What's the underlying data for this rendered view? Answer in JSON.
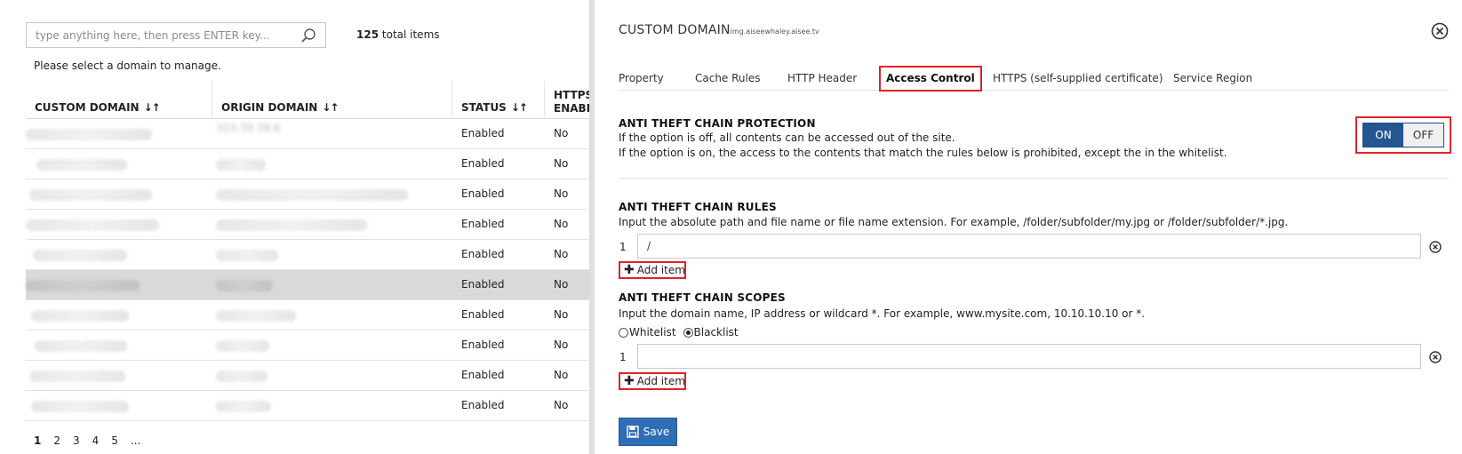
{
  "search": {
    "placeholder": "type anything here, then press ENTER key...",
    "total_count": "125",
    "total_suffix": "total items"
  },
  "select_message": "Please select a domain to manage.",
  "table": {
    "headers": {
      "custom_domain": "CUSTOM DOMAIN",
      "origin_domain": "ORIGIN DOMAIN",
      "status": "STATUS",
      "https_line1": "HTTPS",
      "https_line2": "ENABLED"
    },
    "sort_glyph": "↓↑",
    "rows": [
      {
        "status": "Enabled",
        "https": "No",
        "origin_partial": "103.39.38.6"
      },
      {
        "status": "Enabled",
        "https": "No",
        "origin_partial": ""
      },
      {
        "status": "Enabled",
        "https": "No",
        "origin_partial": ""
      },
      {
        "status": "Enabled",
        "https": "No",
        "origin_partial": ""
      },
      {
        "status": "Enabled",
        "https": "No",
        "origin_partial": ""
      },
      {
        "status": "Enabled",
        "https": "No",
        "origin_partial": ""
      },
      {
        "status": "Enabled",
        "https": "No",
        "origin_partial": ""
      },
      {
        "status": "Enabled",
        "https": "No",
        "origin_partial": ""
      },
      {
        "status": "Enabled",
        "https": "No",
        "origin_partial": ""
      },
      {
        "status": "Enabled",
        "https": "No",
        "origin_partial": ""
      }
    ]
  },
  "pagination": {
    "pages": [
      "1",
      "2",
      "3",
      "4",
      "5",
      "..."
    ],
    "current": "1"
  },
  "panel": {
    "title": "CUSTOM DOMAIN",
    "subtitle": "img.aiseewhaley.aisee.tv",
    "close_icon": "close-circle-icon",
    "tabs": [
      {
        "label": "Property"
      },
      {
        "label": "Cache Rules"
      },
      {
        "label": "HTTP Header"
      },
      {
        "label": "Access Control"
      },
      {
        "label": "HTTPS (self-supplied certificate)"
      },
      {
        "label": "Service Region"
      }
    ],
    "active_tab": "Access Control",
    "protection": {
      "title": "ANTI THEFT CHAIN PROTECTION",
      "desc1": "If the option is off, all contents can be accessed out of the site.",
      "desc2": "If the option is on, the access to the contents that match the rules below is prohibited, except the in the whitelist.",
      "on_label": "ON",
      "off_label": "OFF",
      "state": "ON"
    },
    "rules": {
      "title": "ANTI THEFT CHAIN RULES",
      "desc": "Input the absolute path and file name or file name extension. For example, /folder/subfolder/my.jpg or /folder/subfolder/*.jpg.",
      "items": [
        {
          "index": "1",
          "value": "/"
        }
      ],
      "add_label": "Add item"
    },
    "scopes": {
      "title": "ANTI THEFT CHAIN SCOPES",
      "desc": "Input the domain name, IP address or wildcard *. For example, www.mysite.com, 10.10.10.10 or *.",
      "whitelist_label": "Whitelist",
      "blacklist_label": "Blacklist",
      "selected": "Blacklist",
      "items": [
        {
          "index": "1",
          "value": ""
        }
      ],
      "add_label": "Add item"
    },
    "save_label": "Save"
  },
  "colors": {
    "accent": "#24578f",
    "save_button": "#2f6db5",
    "highlight_border": "#e0232a",
    "selected_row": "#d9d9d9"
  }
}
